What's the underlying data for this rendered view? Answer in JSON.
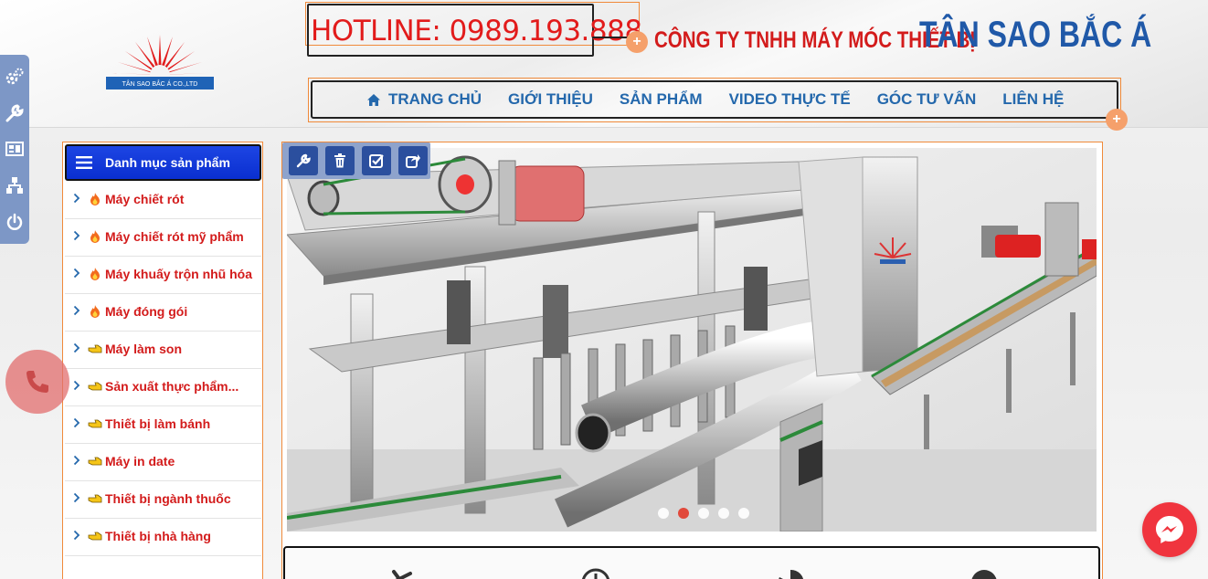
{
  "header": {
    "hotline": "HOTLINE: 0989.193.888",
    "company_prefix": "CÔNG TY TNHH MÁY MÓC THIẾT BỊ",
    "brand": "TÂN SAO BẮC Á",
    "logo_text": "TÂN SAO BẮC Á CO.,LTD"
  },
  "nav": {
    "items": [
      {
        "label": "TRANG CHỦ",
        "icon": "home-icon"
      },
      {
        "label": "GIỚI THIỆU"
      },
      {
        "label": "SẢN PHẨM"
      },
      {
        "label": "VIDEO THỰC TẾ"
      },
      {
        "label": "GÓC TƯ VẤN"
      },
      {
        "label": "LIÊN HỆ"
      }
    ]
  },
  "side_tools": [
    "gears-icon",
    "wrench-icon",
    "layout-icon",
    "sitemap-icon",
    "power-icon"
  ],
  "sidebar": {
    "title": "Danh mục sản phẩm",
    "items": [
      {
        "label": "Máy chiết rót",
        "icon": "fire-icon"
      },
      {
        "label": "Máy chiết rót mỹ phẩm",
        "icon": "fire-icon"
      },
      {
        "label": "Máy khuấy trộn nhũ hóa",
        "icon": "fire-icon"
      },
      {
        "label": "Máy đóng gói",
        "icon": "fire-icon"
      },
      {
        "label": "Máy làm son",
        "icon": "hand-pointer-icon"
      },
      {
        "label": "Sản xuất thực phẩm...",
        "icon": "hand-pointer-icon"
      },
      {
        "label": "Thiết bị làm bánh",
        "icon": "hand-pointer-icon"
      },
      {
        "label": "Máy in date",
        "icon": "hand-pointer-icon"
      },
      {
        "label": "Thiết bị ngành thuốc",
        "icon": "hand-pointer-icon"
      },
      {
        "label": "Thiết bị nhà hàng",
        "icon": "hand-pointer-icon"
      }
    ]
  },
  "editor_toolbar": [
    "wrench-icon",
    "trash-icon",
    "checkbox-icon",
    "share-icon"
  ],
  "slider": {
    "dot_count": 5,
    "active_index": 1
  },
  "colors": {
    "accent_red": "#d31b1b",
    "brand_blue": "#2059a8",
    "nav_blue": "#2468ac",
    "outline_orange": "#f08a3a"
  }
}
